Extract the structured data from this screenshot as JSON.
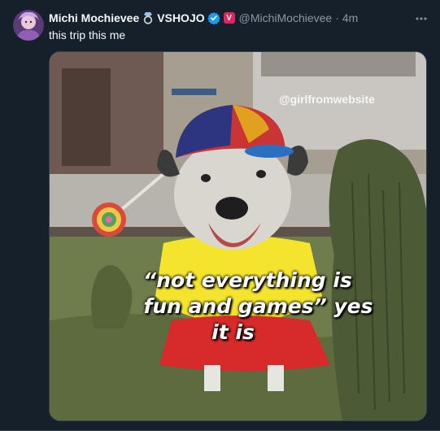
{
  "tweet": {
    "display_name": "Michi Mochievee",
    "org_name": "VSHOJO",
    "affiliate_badge_letter": "V",
    "handle": "@MichiMochievee",
    "time_separator": "·",
    "timestamp": "4m",
    "text": "this trip this me",
    "icons": {
      "ring": "ring-icon",
      "verified": "verified-check-icon",
      "more": "more-options-icon"
    }
  },
  "media": {
    "watermark": "@girlfromwebsite",
    "caption_line1": "“not everything is",
    "caption_line2": "fun and games” yes",
    "caption_line3": "it is"
  },
  "colors": {
    "background": "#15202b",
    "secondary_text": "#8b98a5",
    "verified": "#1d9bf0",
    "affiliate": "#e0245e"
  }
}
